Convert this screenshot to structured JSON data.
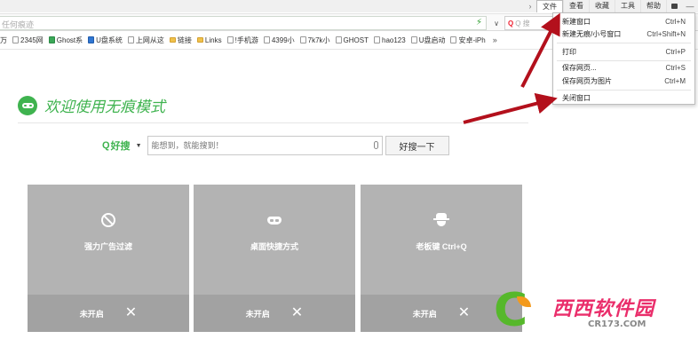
{
  "menubar": {
    "items": [
      "文件",
      "查看",
      "收藏",
      "工具",
      "帮助"
    ],
    "active_index": 0,
    "minimize": "—"
  },
  "address": {
    "url": "任何痕迹",
    "search_placeholder": "Q 搜"
  },
  "bookmarks": {
    "items": [
      {
        "label": "万",
        "icon": "page"
      },
      {
        "label": "2345网",
        "icon": "page"
      },
      {
        "label": "Ghost系",
        "icon": "green"
      },
      {
        "label": "U盘系统",
        "icon": "blue"
      },
      {
        "label": "上网从这",
        "icon": "page"
      },
      {
        "label": "链接",
        "icon": "folder"
      },
      {
        "label": "Links",
        "icon": "folder"
      },
      {
        "label": "!手机游",
        "icon": "page"
      },
      {
        "label": "4399小",
        "icon": "page"
      },
      {
        "label": "7k7k小",
        "icon": "page"
      },
      {
        "label": "GHOST",
        "icon": "page"
      },
      {
        "label": "hao123",
        "icon": "page"
      },
      {
        "label": "U盘启动",
        "icon": "page"
      },
      {
        "label": "安卓-iPh",
        "icon": "page"
      }
    ],
    "more": "»"
  },
  "main": {
    "welcome_title": "欢迎使用无痕模式",
    "search": {
      "brand": "好搜",
      "placeholder": "能想到，就能搜到！",
      "button": "好搜一下"
    },
    "cards": [
      {
        "title": "强力广告过滤",
        "status": "未开启",
        "icon": "ban-icon"
      },
      {
        "title": "桌面快捷方式",
        "status": "未开启",
        "icon": "mask-icon"
      },
      {
        "title": "老板键 Ctrl+Q",
        "status": "未开启",
        "icon": "boss-icon"
      }
    ]
  },
  "file_menu": {
    "items": [
      {
        "label": "新建窗口",
        "shortcut": "Ctrl+N"
      },
      {
        "label": "新建无痕/小号窗口",
        "shortcut": "Ctrl+Shift+N"
      },
      {
        "label": "打印",
        "shortcut": "Ctrl+P"
      },
      {
        "label": "保存网页...",
        "shortcut": "Ctrl+S"
      },
      {
        "label": "保存网页为图片",
        "shortcut": "Ctrl+M"
      },
      {
        "label": "关闭窗口",
        "shortcut": ""
      }
    ]
  },
  "watermark": {
    "cn": "西西软件园",
    "en": "CR173.COM"
  },
  "colors": {
    "accent_green": "#3fb34f",
    "card_bg": "#b3b3b3",
    "arrow_red": "#b3101c"
  }
}
